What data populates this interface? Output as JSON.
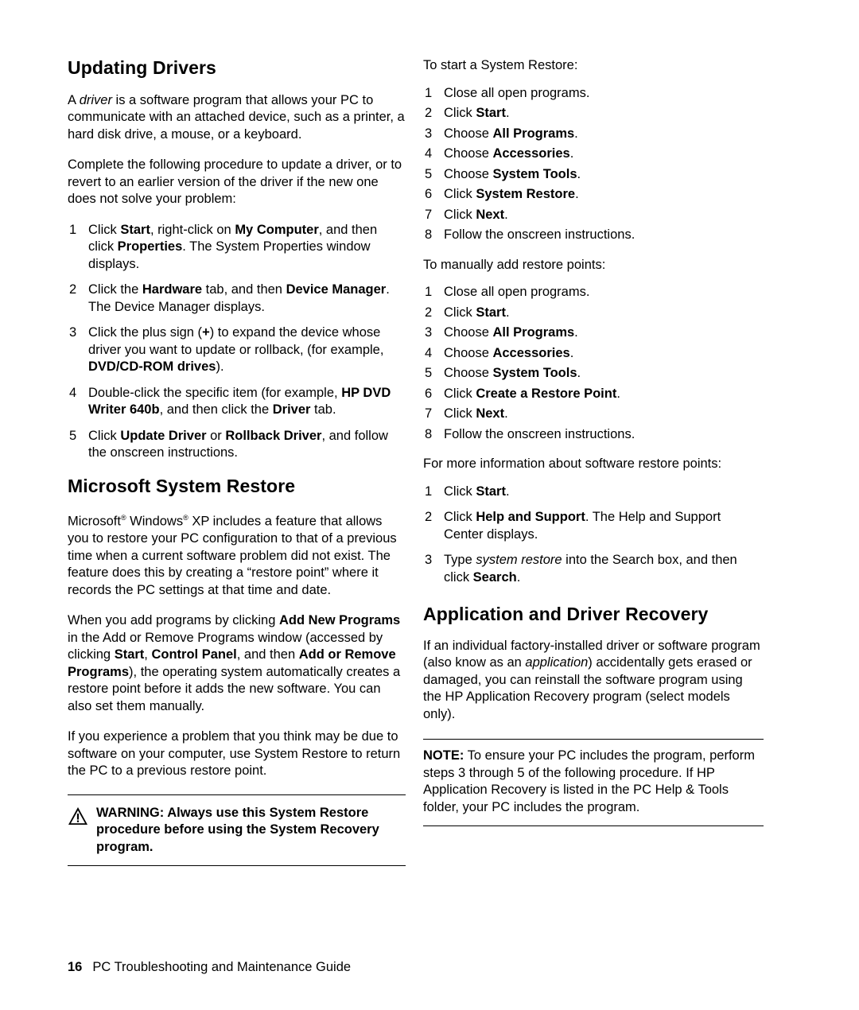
{
  "document": {
    "footer": {
      "page_number": "16",
      "title": "PC Troubleshooting and Maintenance Guide"
    }
  },
  "left_column": {
    "section1": {
      "heading": "Updating Drivers",
      "paragraph1_pre": "A ",
      "paragraph1_em": "driver",
      "paragraph1_post": " is a software program that allows your PC to communicate with an attached device, such as a printer, a hard disk drive, a mouse, or a keyboard.",
      "paragraph2": "Complete the following procedure to update a driver, or to revert to an earlier version of the driver if the new one does not solve your problem:",
      "steps": [
        {
          "num": "1",
          "html": "Click <b>Start</b>, right-click on <b>My Computer</b>, and then click <b>Properties</b>. The System Properties window displays."
        },
        {
          "num": "2",
          "html": "Click the <b>Hardware</b> tab, and then <b>Device Manager</b>. The Device Manager displays."
        },
        {
          "num": "3",
          "html": "Click the plus sign (<b>+</b>) to expand the device whose driver you want to update or rollback, (for example, <b>DVD/CD-ROM drives</b>)."
        },
        {
          "num": "4",
          "html": "Double-click the specific item (for example, <b>HP DVD Writer 640b</b>, and then click the <b>Driver</b> tab."
        },
        {
          "num": "5",
          "html": "Click <b>Update Driver</b> or <b>Rollback Driver</b>, and follow the onscreen instructions."
        }
      ]
    },
    "section2": {
      "heading": "Microsoft System Restore",
      "paragraph1": "Microsoft<span class=\"sup\">®</span> Windows<span class=\"sup\">®</span> XP includes a feature that allows you to restore your PC configuration to that of a previous time when a current software problem did not exist. The feature does this by creating a “restore point” where it records the PC settings at that time and date.",
      "paragraph2": "When you add programs by clicking <b>Add New Programs</b> in the Add or Remove Programs window (accessed by clicking <b>Start</b>, <b>Control Panel</b>, and then <b>Add or Remove Programs</b>), the operating system automatically creates a restore point before it adds the new software. You can also set them manually.",
      "paragraph3": "If you experience a problem that you think may be due to software on your computer, use System Restore to return the PC to a previous restore point."
    },
    "warning": {
      "icon": "warning-triangle-icon",
      "text": "WARNING: Always use this System Restore procedure before using the System Recovery program."
    }
  },
  "right_column": {
    "intro1": "To start a System Restore:",
    "steps1": [
      {
        "num": "1",
        "html": "Close all open programs."
      },
      {
        "num": "2",
        "html": "Click <b>Start</b>."
      },
      {
        "num": "3",
        "html": "Choose <b>All Programs</b>."
      },
      {
        "num": "4",
        "html": "Choose <b>Accessories</b>."
      },
      {
        "num": "5",
        "html": "Choose <b>System Tools</b>."
      },
      {
        "num": "6",
        "html": "Click <b>System Restore</b>."
      },
      {
        "num": "7",
        "html": "Click <b>Next</b>."
      },
      {
        "num": "8",
        "html": "Follow the onscreen instructions."
      }
    ],
    "intro2": "To manually add restore points:",
    "steps2": [
      {
        "num": "1",
        "html": "Close all open programs."
      },
      {
        "num": "2",
        "html": "Click <b>Start</b>."
      },
      {
        "num": "3",
        "html": "Choose <b>All Programs</b>."
      },
      {
        "num": "4",
        "html": "Choose <b>Accessories</b>."
      },
      {
        "num": "5",
        "html": "Choose <b>System Tools</b>."
      },
      {
        "num": "6",
        "html": "Click <b>Create a Restore Point</b>."
      },
      {
        "num": "7",
        "html": "Click <b>Next</b>."
      },
      {
        "num": "8",
        "html": "Follow the onscreen instructions."
      }
    ],
    "intro3": "For more information about software restore points:",
    "steps3": [
      {
        "num": "1",
        "html": "Click <b>Start</b>."
      },
      {
        "num": "2",
        "html": "Click <b>Help and Support</b>. The Help and Support Center displays."
      },
      {
        "num": "3",
        "html": "Type <i>system restore</i> into the Search box, and then click <b>Search</b>."
      }
    ],
    "section": {
      "heading": "Application and Driver Recovery",
      "paragraph1": "If an individual factory-installed driver or software program (also know as an <i>application</i>) accidentally gets erased or damaged, you can reinstall the software program using the HP Application Recovery program (select models only)."
    },
    "note": {
      "text": "<b>NOTE:</b> To ensure your PC includes the program, perform steps 3 through 5 of the following procedure. If HP Application Recovery is listed in the PC Help &amp; Tools folder, your PC includes the program."
    }
  }
}
